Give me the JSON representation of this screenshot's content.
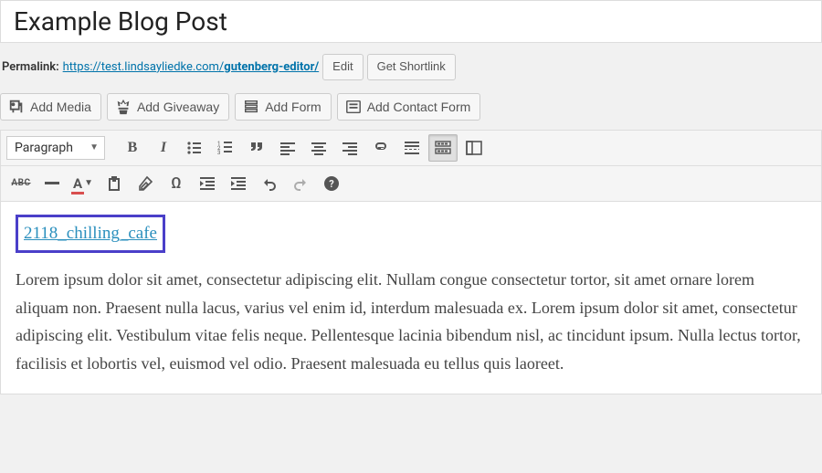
{
  "title": "Example Blog Post",
  "permalink": {
    "label": "Permalink:",
    "base": "https://test.lindsayliedke.com/",
    "slug": "gutenberg-editor/",
    "edit": "Edit",
    "shortlink": "Get Shortlink"
  },
  "media_buttons": {
    "add_media": "Add Media",
    "add_giveaway": "Add Giveaway",
    "add_form": "Add Form",
    "add_contact_form": "Add Contact Form"
  },
  "toolbar": {
    "format": "Paragraph"
  },
  "content": {
    "shortcode_link": "2118_chilling_cafe",
    "paragraph": "Lorem ipsum dolor sit amet, consectetur adipiscing elit. Nullam congue consectetur tortor, sit amet ornare lorem aliquam non. Praesent nulla lacus, varius vel enim id, interdum malesuada ex. Lorem ipsum dolor sit amet, consectetur adipiscing elit. Vestibulum vitae felis neque. Pellentesque lacinia bibendum nisl, ac tincidunt ipsum. Nulla lectus tortor, facilisis et lobortis vel, euismod vel odio. Praesent malesuada eu tellus quis laoreet."
  }
}
